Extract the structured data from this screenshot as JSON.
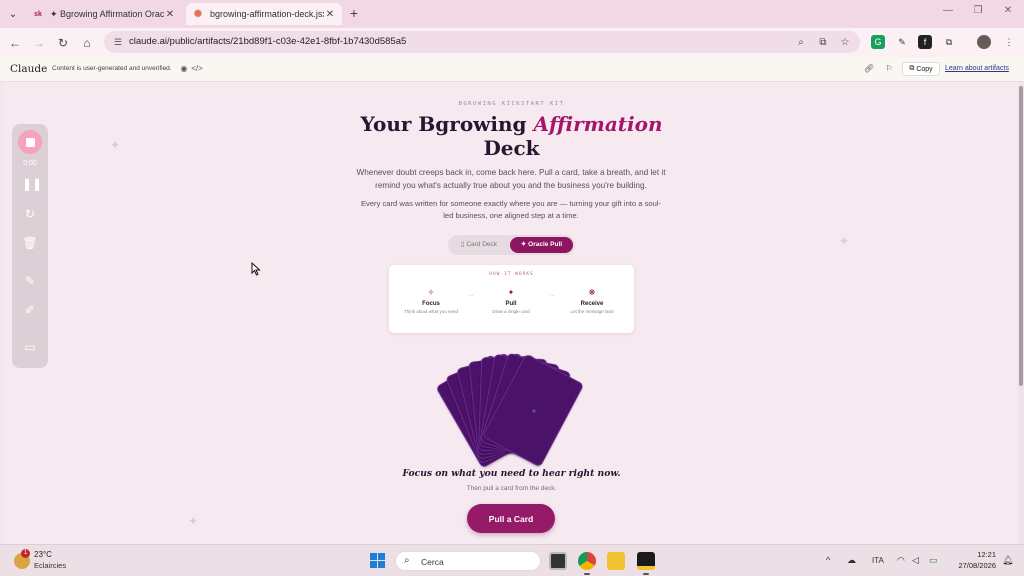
{
  "browser": {
    "tabs": [
      {
        "favicon": "sk",
        "label": "✦ Bgrowing Affirmation Oracle"
      },
      {
        "favicon": "✺",
        "label": "bgrowing-affirmation-deck.jsx"
      }
    ],
    "url": "claude.ai/public/artifacts/21bd89f1-c03e-42e1-8fbf-1b7430d585a5"
  },
  "artifact_header": {
    "brand": "Claude",
    "disclaimer": "Content is user-generated and unverified.",
    "copy_label": "Copy",
    "learn_link": "Learn about artifacts"
  },
  "recorder": {
    "time": "0:00"
  },
  "page": {
    "kicker": "BGROWING KICKSTART KIT",
    "title_part1": "Your Bgrowing ",
    "title_accent": "Affirmation",
    "title_part2": "Deck",
    "lede": "Whenever doubt creeps back in, come back here. Pull a card, take a breath, and let it remind you what's actually true about you and the business you're building.",
    "lede2": "Every card was written for someone exactly where you are — turning your gift into a soul-led business, one aligned step at a time.",
    "toggle": {
      "option1": "▯ Card Deck",
      "option2": "✦ Oracle Pull"
    },
    "how_it_works": {
      "title": "HOW IT WORKS",
      "steps": [
        {
          "icon": "✧",
          "name": "Focus",
          "desc": "Think about what you need"
        },
        {
          "icon": "✦",
          "name": "Pull",
          "desc": "Draw a single card"
        },
        {
          "icon": "❋",
          "name": "Receive",
          "desc": "Let the message land"
        }
      ]
    },
    "prompt": "Focus on what you need to hear right now.",
    "subprompt": "Then pull a card from the deck.",
    "pull_button": "Pull a Card"
  },
  "taskbar": {
    "weather_badge": "1",
    "temperature": "23°C",
    "weather_desc": "Eclaircies",
    "search_placeholder": "Cerca",
    "language": "ITA",
    "time": "12:21",
    "date": "27/08/2026"
  },
  "colors": {
    "accent": "#a3166a",
    "button": "#951a68",
    "card": "#4a1268",
    "background": "#f6e9f0"
  }
}
